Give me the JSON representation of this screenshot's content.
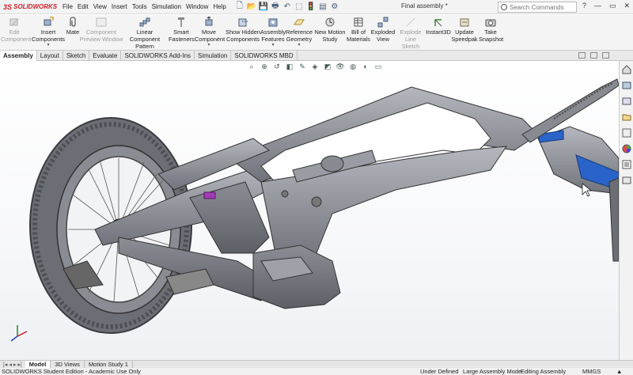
{
  "app": {
    "logo_ds": "3S",
    "logo_name": "SOLIDWORKS",
    "doc_title": "Final assembly *"
  },
  "menu": [
    "File",
    "Edit",
    "View",
    "Insert",
    "Tools",
    "Simulation",
    "Window",
    "Help"
  ],
  "search": {
    "placeholder": "Search Commands"
  },
  "window_buttons": [
    "?",
    "—",
    "▭",
    "✕"
  ],
  "commands": {
    "edit_component": "Edit Component",
    "insert_components": "Insert Components",
    "mate": "Mate",
    "component_preview": "Component Preview Window",
    "linear_pattern": "Linear Component Pattern",
    "smart_fasteners": "Smart Fasteners",
    "move_component": "Move Component",
    "show_hidden": "Show Hidden Components",
    "assembly_features": "Assembly Features",
    "reference_geometry": "Reference Geometry",
    "new_motion_study": "New Motion Study",
    "bill_of_materials": "Bill of Materials",
    "exploded_view": "Exploded View",
    "explode_line_sketch": "Explode Line Sketch",
    "instant3d": "Instant3D",
    "update_speedpak": "Update Speedpak",
    "take_snapshot": "Take Snapshot"
  },
  "tabs": [
    "Assembly",
    "Layout",
    "Sketch",
    "Evaluate",
    "SOLIDWORKS Add-Ins",
    "Simulation",
    "SOLIDWORKS MBD"
  ],
  "bottom_tabs": [
    "Model",
    "3D Views",
    "Motion Study 1"
  ],
  "status": {
    "left": "SOLIDWORKS Student Edition - Academic Use Only",
    "s1": "Under Defined",
    "s2": "Large Assembly Mode",
    "s3": "Editing Assembly",
    "s4": "MMGS",
    "s5": "▲"
  },
  "colors": {
    "accent_red": "#d0202a",
    "part_gray": "#8e9098",
    "part_blue": "#2a64c8"
  }
}
